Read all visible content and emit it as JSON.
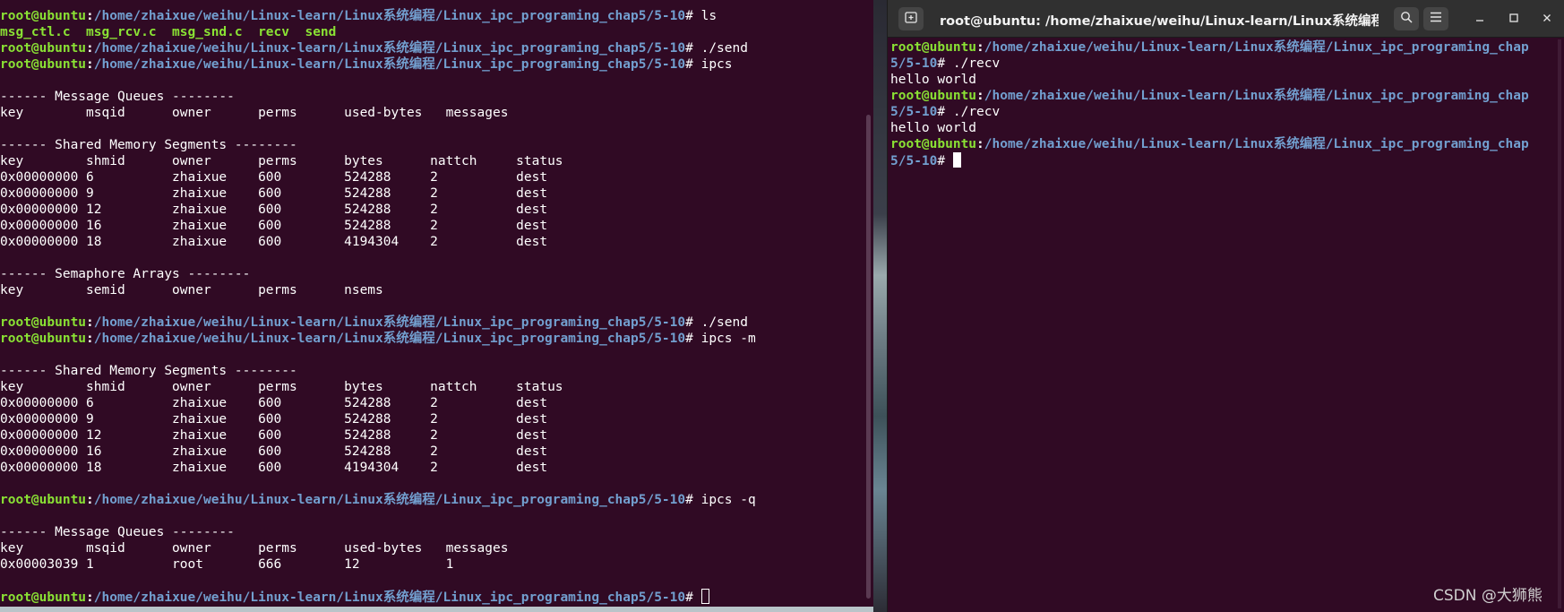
{
  "colors": {
    "terminal_bg": "#300a24",
    "user_host": "#8ae234",
    "path": "#729fcf",
    "file_listing": "#8ae234",
    "titlebar": "#303030"
  },
  "left_terminal": {
    "lines": [
      {
        "prompt": {
          "user": "root@ubuntu",
          "sep": ":",
          "path": "/home/zhaixue/weihu/Linux-learn/Linux系统编程/Linux_ipc_programing_chap5/5-10",
          "suffix": "# "
        },
        "text": "ls"
      },
      {
        "text_green": "msg_ctl.c  msg_rcv.c  msg_snd.c  recv  send"
      },
      {
        "prompt": {
          "user": "root@ubuntu",
          "sep": ":",
          "path": "/home/zhaixue/weihu/Linux-learn/Linux系统编程/Linux_ipc_programing_chap5/5-10",
          "suffix": "# "
        },
        "text": "./send"
      },
      {
        "prompt": {
          "user": "root@ubuntu",
          "sep": ":",
          "path": "/home/zhaixue/weihu/Linux-learn/Linux系统编程/Linux_ipc_programing_chap5/5-10",
          "suffix": "# "
        },
        "text": "ipcs"
      },
      {
        "text": ""
      },
      {
        "text": "------ Message Queues --------"
      },
      {
        "text": "key        msqid      owner      perms      used-bytes   messages"
      },
      {
        "text": ""
      },
      {
        "text": "------ Shared Memory Segments --------"
      },
      {
        "text": "key        shmid      owner      perms      bytes      nattch     status"
      },
      {
        "text": "0x00000000 6          zhaixue    600        524288     2          dest"
      },
      {
        "text": "0x00000000 9          zhaixue    600        524288     2          dest"
      },
      {
        "text": "0x00000000 12         zhaixue    600        524288     2          dest"
      },
      {
        "text": "0x00000000 16         zhaixue    600        524288     2          dest"
      },
      {
        "text": "0x00000000 18         zhaixue    600        4194304    2          dest"
      },
      {
        "text": ""
      },
      {
        "text": "------ Semaphore Arrays --------"
      },
      {
        "text": "key        semid      owner      perms      nsems"
      },
      {
        "text": ""
      },
      {
        "prompt": {
          "user": "root@ubuntu",
          "sep": ":",
          "path": "/home/zhaixue/weihu/Linux-learn/Linux系统编程/Linux_ipc_programing_chap5/5-10",
          "suffix": "# "
        },
        "text": "./send"
      },
      {
        "prompt": {
          "user": "root@ubuntu",
          "sep": ":",
          "path": "/home/zhaixue/weihu/Linux-learn/Linux系统编程/Linux_ipc_programing_chap5/5-10",
          "suffix": "# "
        },
        "text": "ipcs -m"
      },
      {
        "text": ""
      },
      {
        "text": "------ Shared Memory Segments --------"
      },
      {
        "text": "key        shmid      owner      perms      bytes      nattch     status"
      },
      {
        "text": "0x00000000 6          zhaixue    600        524288     2          dest"
      },
      {
        "text": "0x00000000 9          zhaixue    600        524288     2          dest"
      },
      {
        "text": "0x00000000 12         zhaixue    600        524288     2          dest"
      },
      {
        "text": "0x00000000 16         zhaixue    600        524288     2          dest"
      },
      {
        "text": "0x00000000 18         zhaixue    600        4194304    2          dest"
      },
      {
        "text": ""
      },
      {
        "prompt": {
          "user": "root@ubuntu",
          "sep": ":",
          "path": "/home/zhaixue/weihu/Linux-learn/Linux系统编程/Linux_ipc_programing_chap5/5-10",
          "suffix": "# "
        },
        "text": "ipcs -q"
      },
      {
        "text": ""
      },
      {
        "text": "------ Message Queues --------"
      },
      {
        "text": "key        msqid      owner      perms      used-bytes   messages"
      },
      {
        "text": "0x00003039 1          root       666        12           1"
      },
      {
        "text": ""
      },
      {
        "prompt": {
          "user": "root@ubuntu",
          "sep": ":",
          "path": "/home/zhaixue/weihu/Linux-learn/Linux系统编程/Linux_ipc_programing_chap5/5-10",
          "suffix": "# "
        },
        "text": "",
        "cursor": "hollow"
      }
    ]
  },
  "right_terminal": {
    "title": "root@ubuntu: /home/zhaixue/weihu/Linux-learn/Linux系统编程/Li...",
    "icons": {
      "new_tab": "new-tab-icon",
      "search": "search-icon",
      "menu": "hamburger-menu-icon",
      "minimize": "minimize-icon",
      "maximize": "maximize-icon",
      "close": "close-icon"
    },
    "lines": [
      {
        "prompt": {
          "user": "root@ubuntu",
          "sep": ":",
          "path": "/home/zhaixue/weihu/Linux-learn/Linux系统编程/Linux_ipc_programing_chap",
          "suffix": ""
        },
        "text": ""
      },
      {
        "prompt": {
          "user": "",
          "sep": "",
          "path": "5/5-10",
          "suffix": "# "
        },
        "text": "./recv"
      },
      {
        "text": "hello world"
      },
      {
        "prompt": {
          "user": "root@ubuntu",
          "sep": ":",
          "path": "/home/zhaixue/weihu/Linux-learn/Linux系统编程/Linux_ipc_programing_chap",
          "suffix": ""
        },
        "text": ""
      },
      {
        "prompt": {
          "user": "",
          "sep": "",
          "path": "5/5-10",
          "suffix": "# "
        },
        "text": "./recv"
      },
      {
        "text": "hello world"
      },
      {
        "prompt": {
          "user": "root@ubuntu",
          "sep": ":",
          "path": "/home/zhaixue/weihu/Linux-learn/Linux系统编程/Linux_ipc_programing_chap",
          "suffix": ""
        },
        "text": ""
      },
      {
        "prompt": {
          "user": "",
          "sep": "",
          "path": "5/5-10",
          "suffix": "# "
        },
        "text": "",
        "cursor": "solid"
      }
    ]
  },
  "watermark": "CSDN @大狮熊"
}
